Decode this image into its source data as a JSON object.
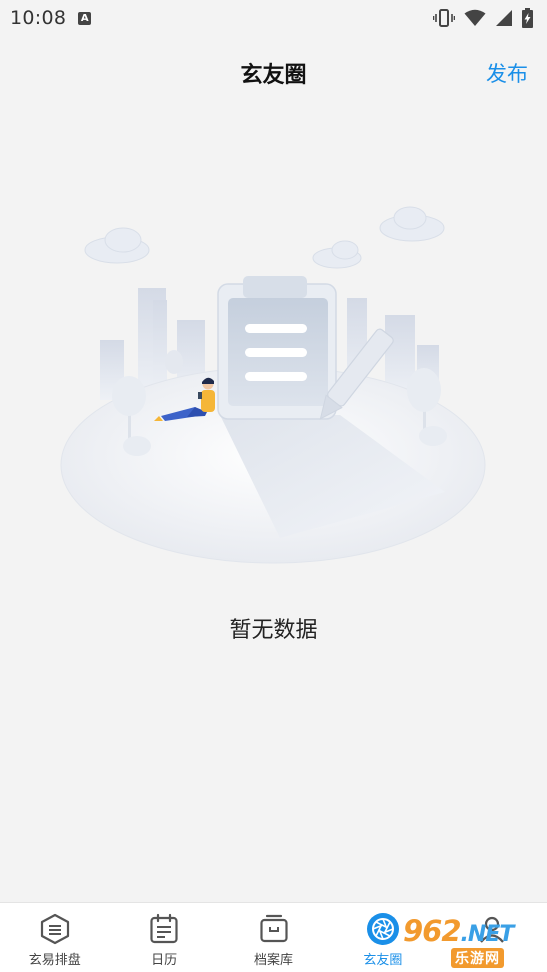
{
  "status_bar": {
    "time": "10:08",
    "notification_letter": "A",
    "icons": [
      "vibrate-icon",
      "wifi-icon",
      "signal-icon",
      "battery-charging-icon"
    ]
  },
  "header": {
    "title": "玄友圈",
    "publish_label": "发布"
  },
  "empty_state": {
    "message": "暂无数据",
    "illustration": "empty-data-illustration"
  },
  "tabs": [
    {
      "label": "玄易排盘",
      "icon": "chart-icon",
      "active": false
    },
    {
      "label": "日历",
      "icon": "calendar-icon",
      "active": false
    },
    {
      "label": "档案库",
      "icon": "archive-icon",
      "active": false
    },
    {
      "label": "玄友圈",
      "icon": "aperture-icon",
      "active": true
    },
    {
      "label": "",
      "icon": "profile-icon",
      "active": false
    }
  ],
  "watermark": {
    "site": "962",
    "tld": ".NET",
    "sub": "乐游网"
  },
  "colors": {
    "accent": "#1a8fe8",
    "background": "#f3f3f3",
    "tabbar_bg": "#ffffff"
  }
}
